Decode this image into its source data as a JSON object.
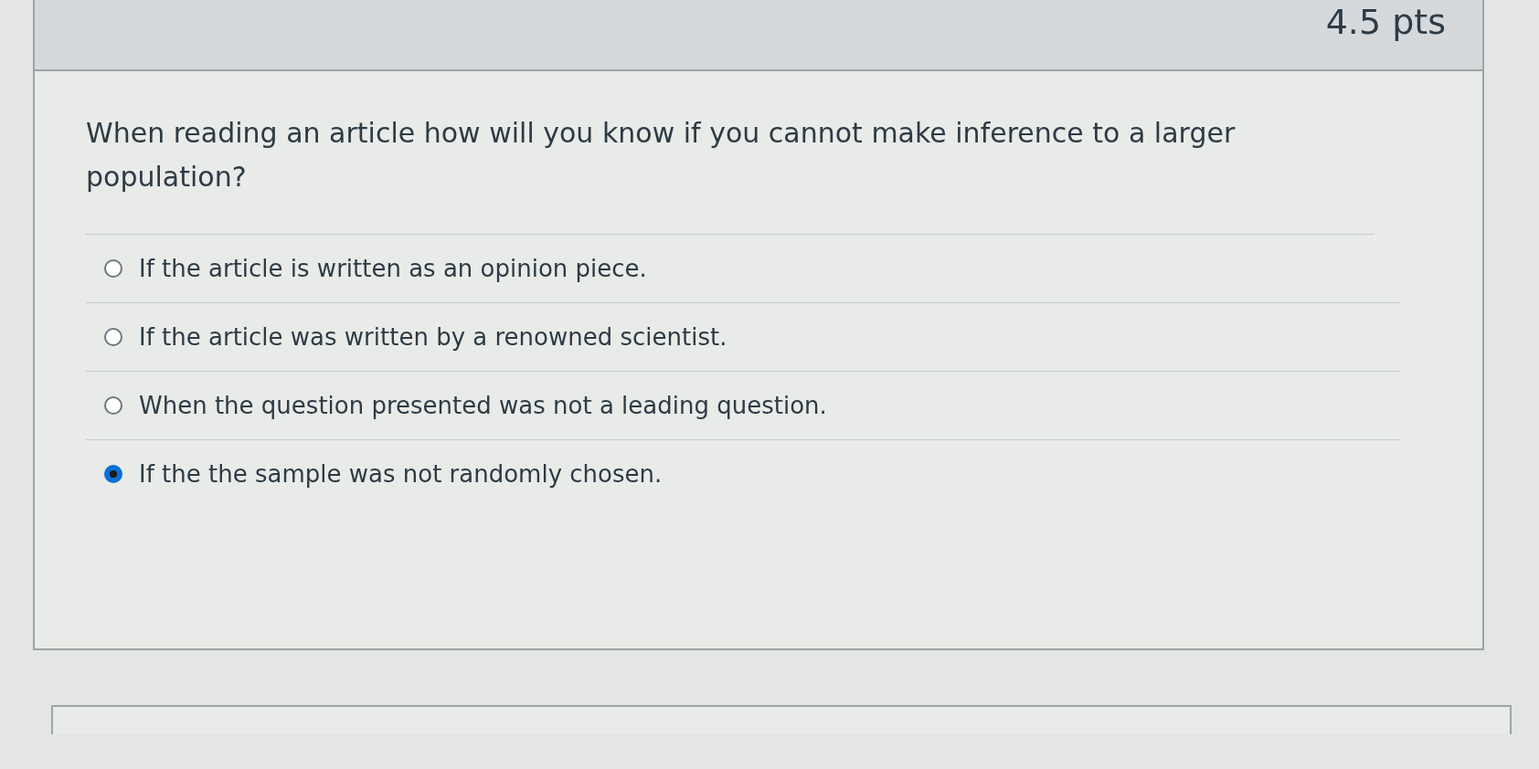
{
  "question": {
    "points": "4.5 pts",
    "text": "When reading an article how will you know if you cannot make inference to a larger population?",
    "answers": [
      {
        "label": "If the article is written as an opinion piece.",
        "selected": false
      },
      {
        "label": "If the article was written by a renowned scientist.",
        "selected": false
      },
      {
        "label": "When the question presented was not a leading question.",
        "selected": false
      },
      {
        "label": "If the the sample was not randomly chosen.",
        "selected": true
      }
    ]
  }
}
